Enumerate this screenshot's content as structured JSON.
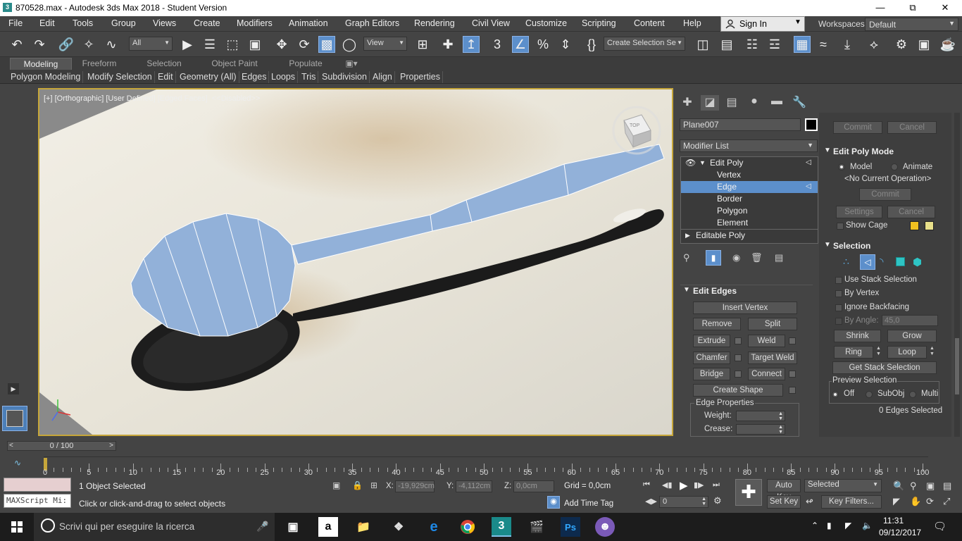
{
  "title": "870528.max - Autodesk 3ds Max 2018 - Student Version",
  "menu": [
    "File",
    "Edit",
    "Tools",
    "Group",
    "Views",
    "Create",
    "Modifiers",
    "Animation",
    "Graph Editors",
    "Rendering",
    "Civil View",
    "Customize",
    "Scripting",
    "Content",
    "Help"
  ],
  "signin": "Sign In",
  "workspaces_label": "Workspaces:",
  "workspace": "Default",
  "toolbar": {
    "filter": "All",
    "refcoord": "View",
    "named_sel": "Create Selection Se"
  },
  "ribbon_tabs": [
    "Modeling",
    "Freeform",
    "Selection",
    "Object Paint",
    "Populate"
  ],
  "ribbon_items": [
    "Polygon Modeling",
    "Modify Selection",
    "Edit",
    "Geometry (All)",
    "Edges",
    "Loops",
    "Tris",
    "Subdivision",
    "Align",
    "Properties"
  ],
  "viewport_label": "[+] [Orthographic] [User Defined] [Edged Faces]  <<Disabled>>",
  "viewcube_label": "TOP",
  "panel": {
    "object_name": "Plane007",
    "modifier_list": "Modifier List",
    "stack": {
      "edit_poly": "Edit Poly",
      "vertex": "Vertex",
      "edge": "Edge",
      "border": "Border",
      "polygon": "Polygon",
      "element": "Element",
      "editable_poly": "Editable Poly"
    },
    "edit_edges": {
      "title": "Edit Edges",
      "insert_vertex": "Insert Vertex",
      "remove": "Remove",
      "split": "Split",
      "extrude": "Extrude",
      "weld": "Weld",
      "chamfer": "Chamfer",
      "target_weld": "Target Weld",
      "bridge": "Bridge",
      "connect": "Connect",
      "create_shape": "Create Shape",
      "edge_properties": "Edge Properties",
      "weight": "Weight:",
      "crease": "Crease:"
    },
    "top_commit": "Commit",
    "top_cancel": "Cancel",
    "edit_poly_mode": {
      "title": "Edit Poly Mode",
      "model": "Model",
      "animate": "Animate",
      "operation": "<No Current Operation>",
      "commit": "Commit",
      "settings": "Settings",
      "cancel": "Cancel",
      "show_cage": "Show Cage",
      "cage_color1": "#f0c020",
      "cage_color2": "#e8e08a"
    },
    "selection": {
      "title": "Selection",
      "use_stack": "Use Stack Selection",
      "by_vertex": "By Vertex",
      "ignore_backfacing": "Ignore Backfacing",
      "by_angle": "By Angle:",
      "angle_value": "45,0",
      "shrink": "Shrink",
      "grow": "Grow",
      "ring": "Ring",
      "loop": "Loop",
      "get_stack": "Get Stack Selection",
      "preview": "Preview Selection",
      "off": "Off",
      "subobj": "SubObj",
      "multi": "Multi",
      "count": "0 Edges Selected"
    }
  },
  "timeline": {
    "slider": "0 / 100",
    "ticks": [
      "0",
      "5",
      "10",
      "15",
      "20",
      "25",
      "30",
      "35",
      "40",
      "45",
      "50",
      "55",
      "60",
      "65",
      "70",
      "75",
      "80",
      "85",
      "90",
      "95",
      "100"
    ]
  },
  "status": {
    "maxscript": "MAXScript Mi:",
    "objects": "1 Object Selected",
    "prompt": "Click or click-and-drag to select objects",
    "x_label": "X:",
    "x_value": "-19,929cm",
    "y_label": "Y:",
    "y_value": "-4,112cm",
    "z_label": "Z:",
    "z_value": "0,0cm",
    "grid": "Grid = 0,0cm",
    "add_time_tag": "Add Time Tag",
    "auto_key": "Auto Key",
    "selected": "Selected",
    "set_key": "Set Key",
    "key_filters": "Key Filters...",
    "frame": "0"
  },
  "taskbar": {
    "search": "Scrivi qui per eseguire la ricerca",
    "time": "11:31",
    "date": "09/12/2017"
  }
}
